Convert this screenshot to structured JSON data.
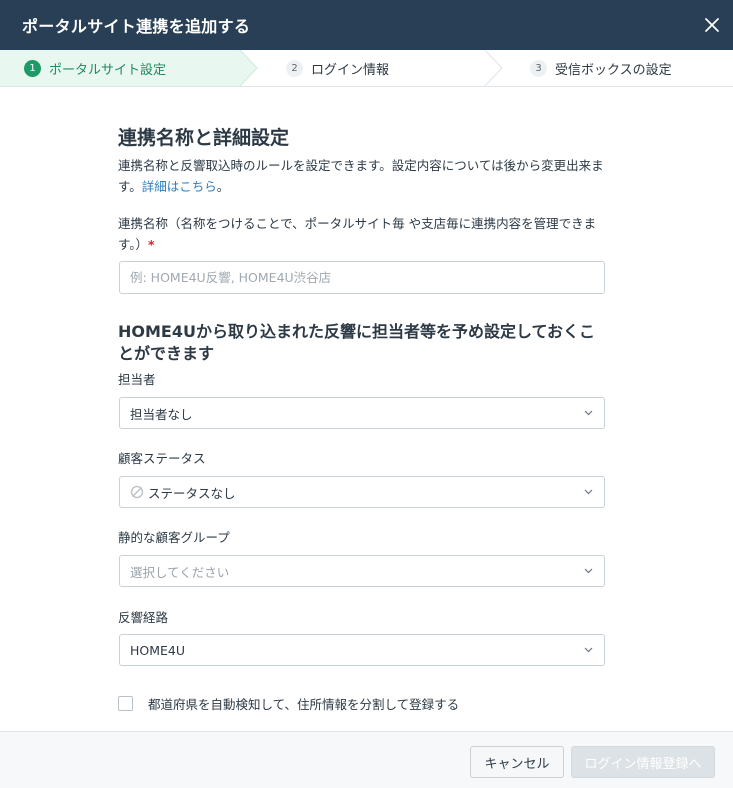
{
  "header": {
    "title": "ポータルサイト連携を追加する"
  },
  "steps": [
    {
      "num": "1",
      "label": "ポータルサイト設定"
    },
    {
      "num": "2",
      "label": "ログイン情報"
    },
    {
      "num": "3",
      "label": "受信ボックスの設定"
    }
  ],
  "section": {
    "title": "連携名称と詳細設定",
    "desc_text": "連携名称と反響取込時のルールを設定できます。設定内容については後から変更出来ます。",
    "desc_link": "詳細はこちら",
    "desc_tail": "。"
  },
  "name_field": {
    "label": "連携名称（名称をつけることで、ポータルサイト毎 や支店毎に連携内容を管理できます。）",
    "required_mark": "*",
    "placeholder": "例: HOME4U反響, HOME4U渋谷店",
    "value": ""
  },
  "defaults_title": "HOME4Uから取り込まれた反響に担当者等を予め設定しておくことができます",
  "fields": {
    "assignee": {
      "label": "担当者",
      "value": "担当者なし"
    },
    "status": {
      "label": "顧客ステータス",
      "value": "ステータスなし"
    },
    "group": {
      "label": "静的な顧客グループ",
      "value": "選択してください"
    },
    "route": {
      "label": "反響経路",
      "value": "HOME4U"
    }
  },
  "checkbox": {
    "label": "都道府県を自動検知して、住所情報を分割して登録する",
    "checked": false
  },
  "footer": {
    "cancel_label": "キャンセル",
    "next_label": "ログイン情報登録へ"
  },
  "colors": {
    "header_bg": "#283f55",
    "step_active": "#1d9a68",
    "link": "#2a7fbf",
    "required": "#d6202a"
  }
}
